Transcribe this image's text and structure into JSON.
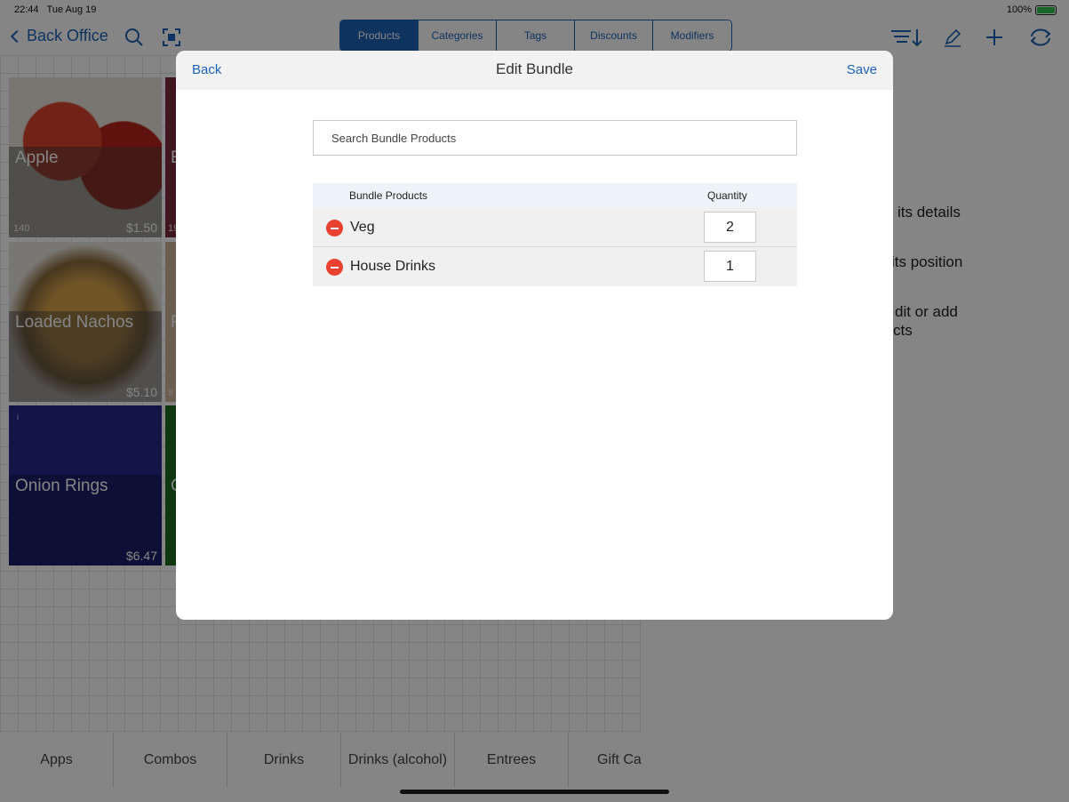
{
  "status_bar": {
    "time": "22:44",
    "date": "Tue Aug 19",
    "battery": "100%"
  },
  "nav": {
    "back_label": "Back Office",
    "segments": [
      "Products",
      "Categories",
      "Tags",
      "Discounts",
      "Modifiers"
    ],
    "active_segment": "Products"
  },
  "tiles": [
    {
      "name": "Apple",
      "count": "140",
      "price": "$1.50"
    },
    {
      "name": "Loaded Nachos",
      "count": "",
      "price": "$5.10"
    },
    {
      "name": "Onion Rings",
      "count": "",
      "price": "$6.47"
    }
  ],
  "partial_tiles": [
    {
      "letter": "E",
      "num": "19"
    },
    {
      "letter": "F",
      "num": "8"
    },
    {
      "letter": "C",
      "num": ""
    }
  ],
  "hints": [
    "its details",
    "its position",
    "dit or add",
    "cts"
  ],
  "categories": [
    "Apps",
    "Combos",
    "Drinks",
    "Drinks (alcohol)",
    "Entrees",
    "Gift Ca"
  ],
  "modal": {
    "back_label": "Back",
    "title": "Edit Bundle",
    "save_label": "Save",
    "search_placeholder": "Search Bundle Products",
    "columns": {
      "name": "Bundle Products",
      "quantity": "Quantity"
    },
    "rows": [
      {
        "name": "Veg",
        "quantity": "2"
      },
      {
        "name": "House Drinks",
        "quantity": "1"
      }
    ]
  },
  "colors": {
    "accent": "#1c63b7",
    "remove": "#e8412f",
    "table_header": "#edf3f7"
  }
}
